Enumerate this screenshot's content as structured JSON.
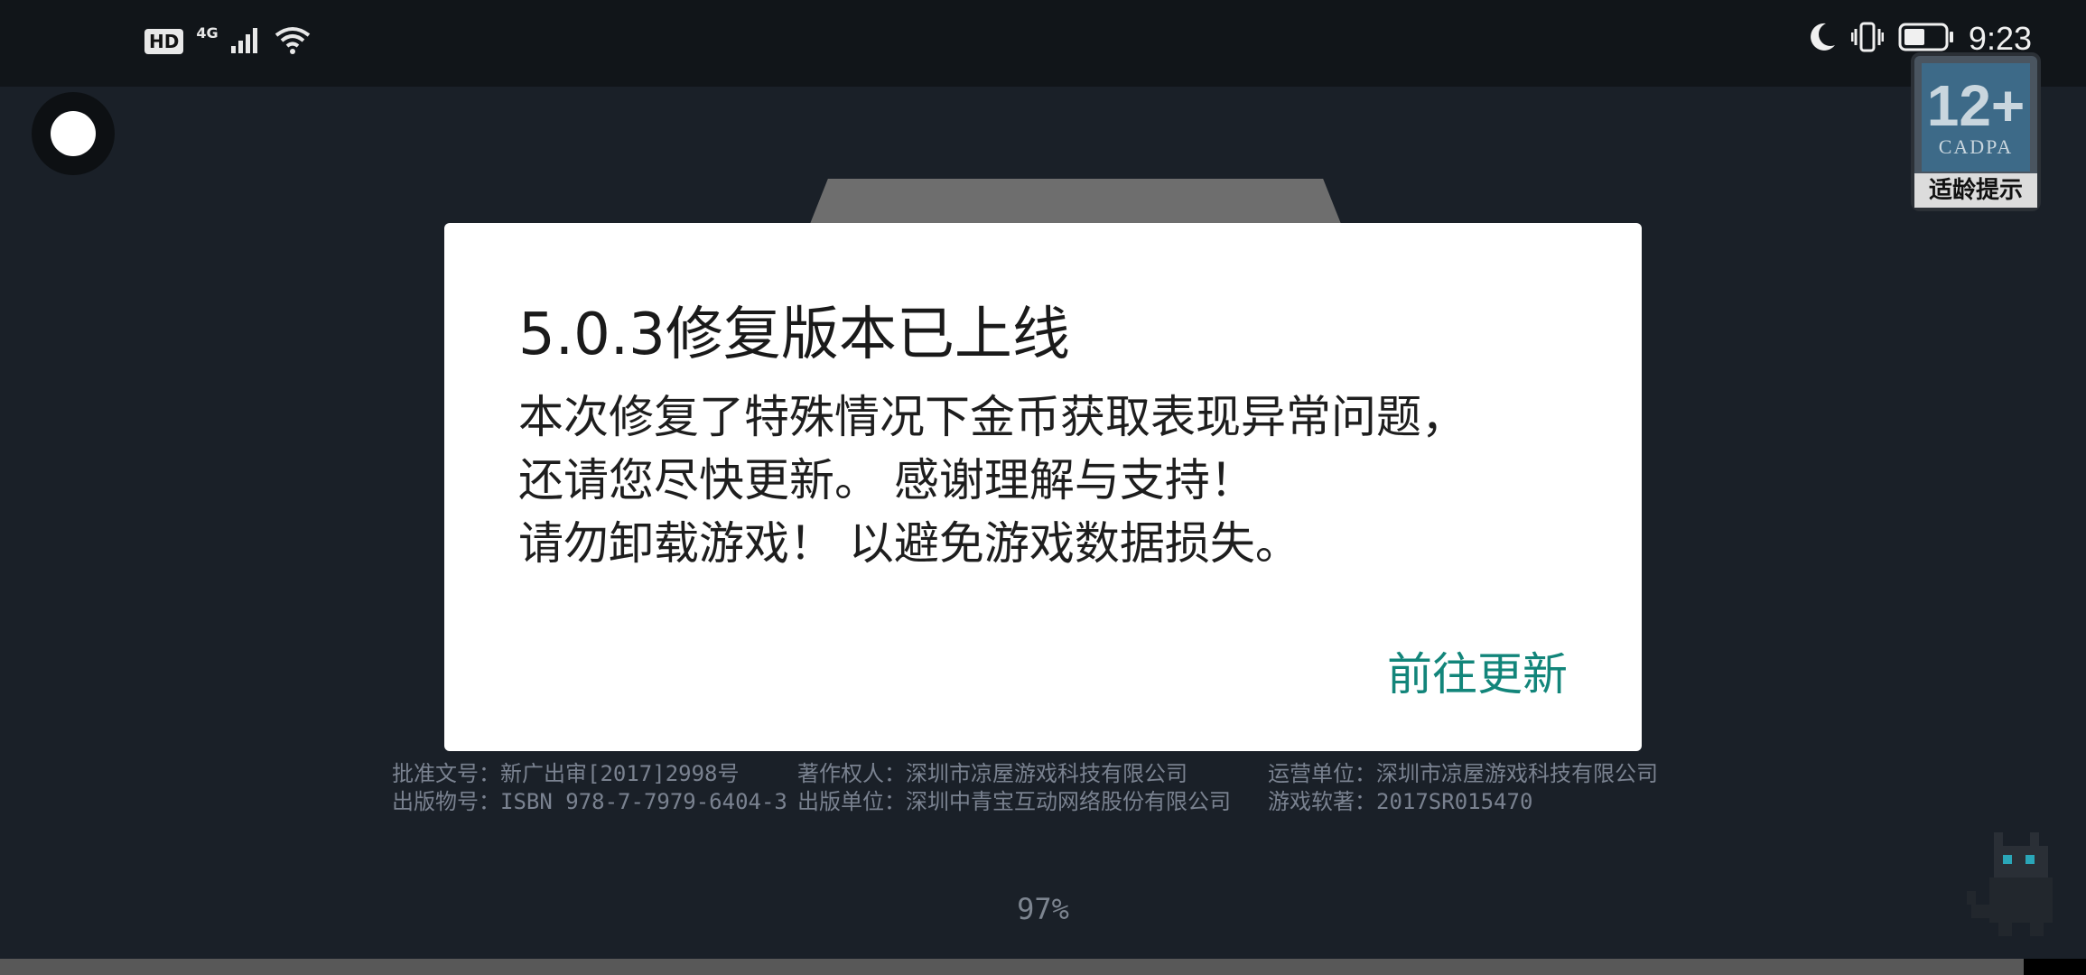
{
  "status_bar": {
    "hd": "HD",
    "network": "4G",
    "time": "9:23",
    "icons": [
      "hd-icon",
      "signal-icon",
      "wifi-icon",
      "moon-icon",
      "vibrate-icon",
      "battery-icon"
    ]
  },
  "age_rating": {
    "number": "12+",
    "org": "CADPA",
    "caption": "适龄提示"
  },
  "dialog": {
    "title": "5.0.3修复版本已上线",
    "lines": [
      "本次修复了特殊情况下金币获取表现异常问题，",
      "还请您尽快更新。 感谢理解与支持！",
      "请勿卸载游戏！ 以避免游戏数据损失。"
    ],
    "action": "前往更新",
    "action_color": "#12857a"
  },
  "info": {
    "row1": [
      "批准文号：新广出审[2017]2998号",
      "著作权人：深圳市凉屋游戏科技有限公司",
      "运营单位：深圳市凉屋游戏科技有限公司"
    ],
    "row2": [
      "出版物号：ISBN 978-7-7979-6404-3",
      "出版单位：深圳中青宝互动网络股份有限公司",
      "游戏软著：2017SR015470"
    ]
  },
  "loading": {
    "percent_text": "97%",
    "progress": 0.97
  },
  "colors": {
    "background": "#1a2028",
    "overlay_status": "#111519"
  }
}
